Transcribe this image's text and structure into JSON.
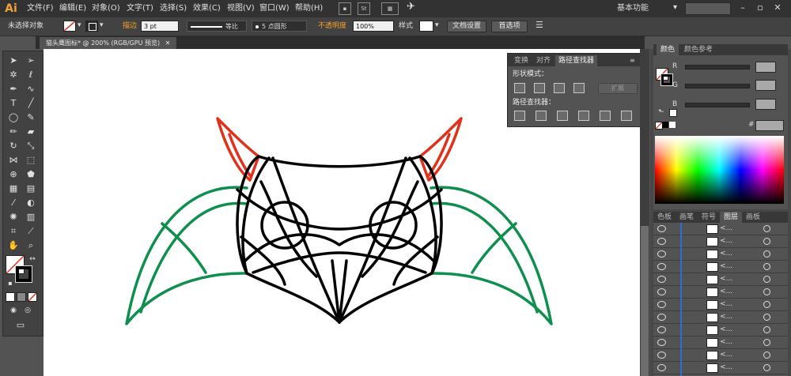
{
  "menubar": {
    "logo": "Ai",
    "items": [
      "文件(F)",
      "编辑(E)",
      "对象(O)",
      "文字(T)",
      "选择(S)",
      "效果(C)",
      "视图(V)",
      "窗口(W)",
      "帮助(H)"
    ],
    "st_label": "St",
    "workspace": "基本功能"
  },
  "controlbar": {
    "selection": "未选择对象",
    "stroke_label": "描边",
    "stroke_value": "3 pt",
    "profile": "等比",
    "brush": "5 点圆形",
    "opacity_label": "不透明度",
    "opacity_value": "100%",
    "style_label": "样式",
    "doc_settings": "文档设置",
    "preferences": "首选项"
  },
  "document": {
    "tab_title": "猫头鹰图标* @ 200% (RGB/GPU 预览)"
  },
  "pathfinder": {
    "tabs": [
      "变换",
      "对齐",
      "路径查找器"
    ],
    "shape_modes_label": "形状模式：",
    "pathfinders_label": "路径查找器：",
    "expand_label": "扩展"
  },
  "colorpanel": {
    "tabs": [
      "颜色",
      "颜色参考"
    ],
    "r_label": "R",
    "g_label": "G",
    "b_label": "B",
    "hash": "#"
  },
  "layerspanel": {
    "tabs": [
      "色板",
      "画笔",
      "符号",
      "图层",
      "画板"
    ],
    "rows": [
      "<...",
      "<...",
      "<...",
      "<...",
      "<...",
      "<...",
      "<...",
      "<...",
      "<...",
      "<...",
      "<...",
      "<..."
    ]
  },
  "colors": {
    "outline": "#000000",
    "ear": "#e0311a",
    "wing": "#0f8f4e",
    "accent": "#f7a033"
  }
}
